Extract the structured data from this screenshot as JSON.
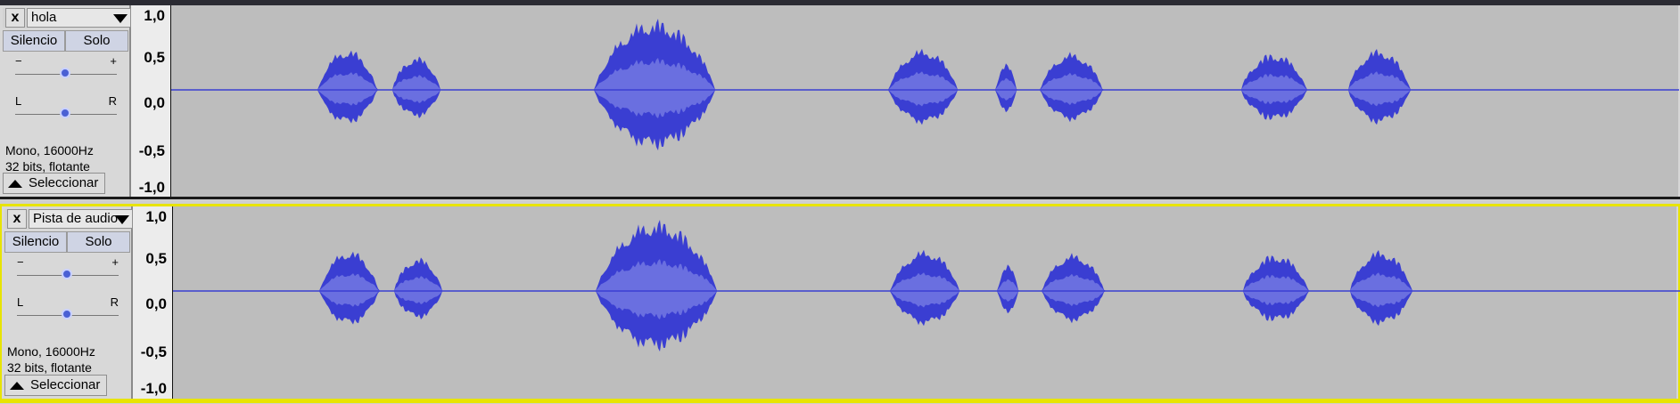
{
  "tracks": [
    {
      "close_icon": "x",
      "name": "hola",
      "mute_label": "Silencio",
      "solo_label": "Solo",
      "gain_minus": "−",
      "gain_plus": "+",
      "pan_left": "L",
      "pan_right": "R",
      "info_line1": "Mono, 16000Hz",
      "info_line2": "32 bits, flotante",
      "select_label": "Seleccionar",
      "ruler": [
        "1,0",
        "0,5",
        "0,0",
        "-0,5",
        "-1,0"
      ]
    },
    {
      "close_icon": "x",
      "name": "Pista de audio",
      "mute_label": "Silencio",
      "solo_label": "Solo",
      "gain_minus": "−",
      "gain_plus": "+",
      "pan_left": "L",
      "pan_right": "R",
      "info_line1": "Mono, 16000Hz",
      "info_line2": "32 bits, flotante",
      "select_label": "Seleccionar",
      "ruler": [
        "1,0",
        "0,5",
        "0,0",
        "-0,5",
        "-1,0"
      ]
    }
  ],
  "colors": {
    "wave_peak": "#3a3ed2",
    "wave_rms": "#6a6fe0",
    "background": "#bdbdbd",
    "selected_border": "#e8e400"
  },
  "icons": [
    "close-icon",
    "menu-arrow-icon",
    "collapse-up-icon",
    "slider-knob-icon"
  ]
}
